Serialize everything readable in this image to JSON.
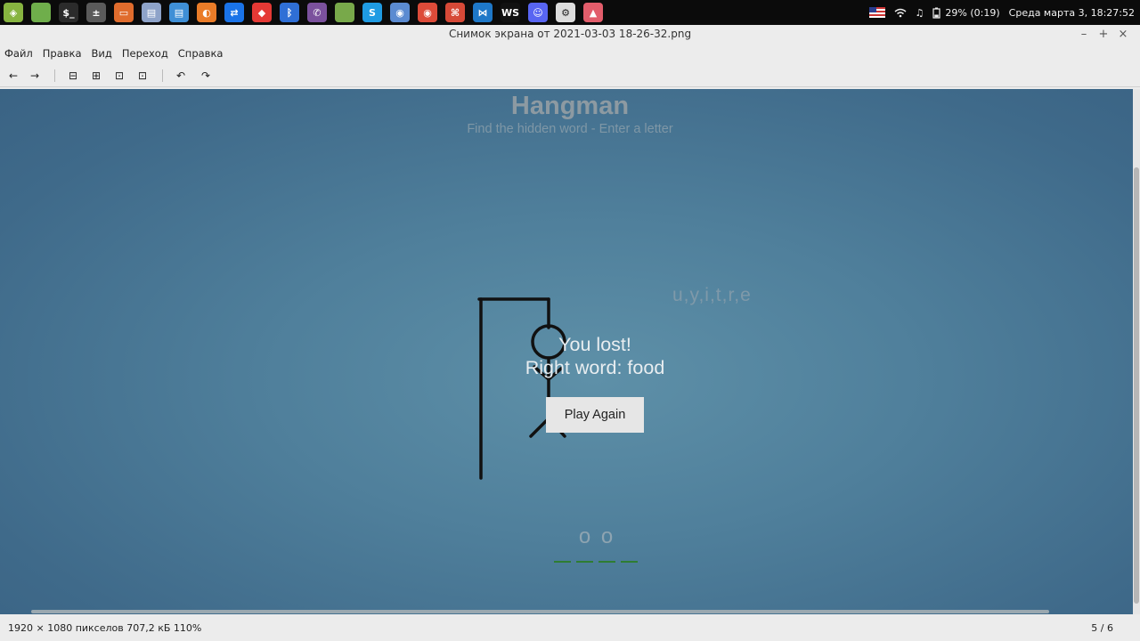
{
  "panel": {
    "apps": [
      {
        "icon": "mint-menu-icon",
        "color": "#87b440",
        "glyph": "◈"
      },
      {
        "icon": "files-icon",
        "color": "#6fae4b",
        "glyph": ""
      },
      {
        "icon": "terminal-icon",
        "color": "#2b2b2b",
        "glyph": "$_"
      },
      {
        "icon": "calculator-icon",
        "color": "#5a5a5a",
        "glyph": "±"
      },
      {
        "icon": "presentation-icon",
        "color": "#e06c2d",
        "glyph": "▭"
      },
      {
        "icon": "document-viewer-icon",
        "color": "#8ea3c9",
        "glyph": "▤"
      },
      {
        "icon": "writer-icon",
        "color": "#3f8fd6",
        "glyph": "▤"
      },
      {
        "icon": "blender-icon",
        "color": "#ea7c28",
        "glyph": "◐"
      },
      {
        "icon": "teamviewer-icon",
        "color": "#1a73e8",
        "glyph": "⇄"
      },
      {
        "icon": "anydesk-icon",
        "color": "#e53935",
        "glyph": "◆"
      },
      {
        "icon": "bluetooth-icon",
        "color": "#2f6fd6",
        "glyph": "ᛒ"
      },
      {
        "icon": "viber-icon",
        "color": "#7b519d",
        "glyph": "✆"
      },
      {
        "icon": "folder-icon",
        "color": "#78a94a",
        "glyph": ""
      },
      {
        "icon": "skype-icon",
        "color": "#1f9be3",
        "glyph": "S"
      },
      {
        "icon": "chromium-icon",
        "color": "#5b8bd1",
        "glyph": "◉"
      },
      {
        "icon": "chrome-icon",
        "color": "#dd4b39",
        "glyph": "◉"
      },
      {
        "icon": "gitkraken-icon",
        "color": "#d64937",
        "glyph": "⌘"
      },
      {
        "icon": "vscode-icon",
        "color": "#1e78c8",
        "glyph": "⋈"
      },
      {
        "icon": "webstorm-icon",
        "color": "#111111",
        "glyph": "WS"
      },
      {
        "icon": "discord-icon",
        "color": "#5865f2",
        "glyph": "☺"
      },
      {
        "icon": "settings-icon",
        "color": "#dcdcdc",
        "glyph": "⚙"
      },
      {
        "icon": "image-viewer-icon",
        "color": "#e25d6b",
        "glyph": "▲"
      }
    ],
    "battery": "29% (0:19)",
    "datetime": "Среда марта  3, 18:27:52"
  },
  "window": {
    "title": "Снимок экрана от 2021-03-03 18-26-32.png",
    "minimize": "–",
    "maximize": "+",
    "close": "×"
  },
  "menu": [
    "Файл",
    "Правка",
    "Вид",
    "Переход",
    "Справка"
  ],
  "toolbar": {
    "back": "←",
    "forward": "→",
    "zoom_out": "⊟",
    "zoom_in": "⊞",
    "zoom_fit": "⊡",
    "zoom_normal": "⊡",
    "rotate_left": "↶",
    "rotate_right": "↷"
  },
  "game": {
    "title": "Hangman",
    "subtitle": "Find the hidden word - Enter a letter",
    "wrong_letters": "u,y,i,t,r,e",
    "message_line1": "You lost!",
    "message_line2": "Right word: food",
    "play_again": "Play Again",
    "word_slots": [
      "",
      "o",
      "o",
      ""
    ]
  },
  "status": {
    "info": "1920 × 1080 пикселов  707,2 кБ   110%",
    "page": "5 / 6"
  }
}
